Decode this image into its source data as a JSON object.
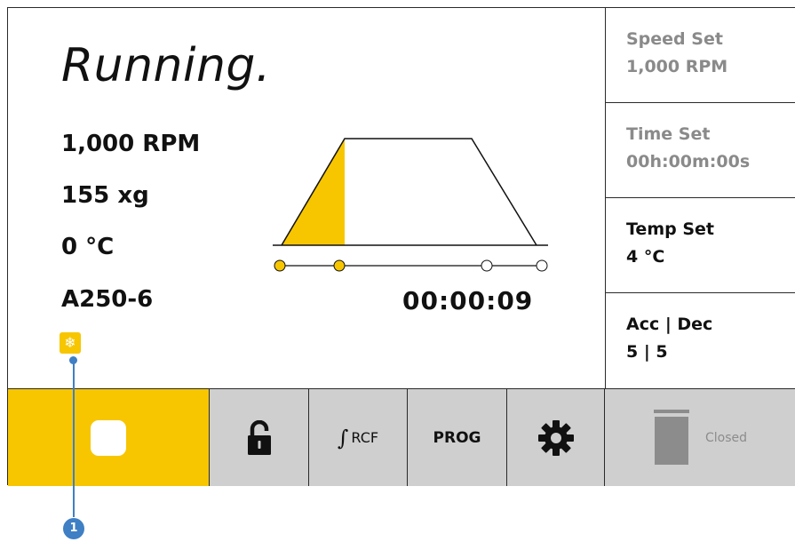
{
  "status": {
    "title": "Running.",
    "speed": "1,000 RPM",
    "force": "155 xg",
    "temperature": "0 °C",
    "rotor": "A250-6",
    "elapsed": "00:00:09",
    "cooling_icon": "snowflake-icon",
    "cooling_glyph": "❄"
  },
  "settings": {
    "speed": {
      "label": "Speed Set",
      "value": "1,000 RPM"
    },
    "time": {
      "label": "Time Set",
      "value": "00h:00m:00s"
    },
    "temp": {
      "label": "Temp Set",
      "value": "4 °C"
    },
    "accdec": {
      "label": "Acc | Dec",
      "value": "5 | 5"
    }
  },
  "toolbar": {
    "stop_icon": "stop-icon",
    "lock_icon": "unlock-icon",
    "rcf_symbol": "∫",
    "rcf_label": "RCF",
    "prog_label": "PROG",
    "settings_icon": "gear-icon",
    "lid_icon": "lid-icon",
    "lid_label": "Closed"
  },
  "callout": {
    "number": "1"
  },
  "colors": {
    "accent": "#f7c600",
    "button_gray": "#cfcfcf",
    "muted_text": "#8a8a8a",
    "callout": "#3f7fc4"
  }
}
